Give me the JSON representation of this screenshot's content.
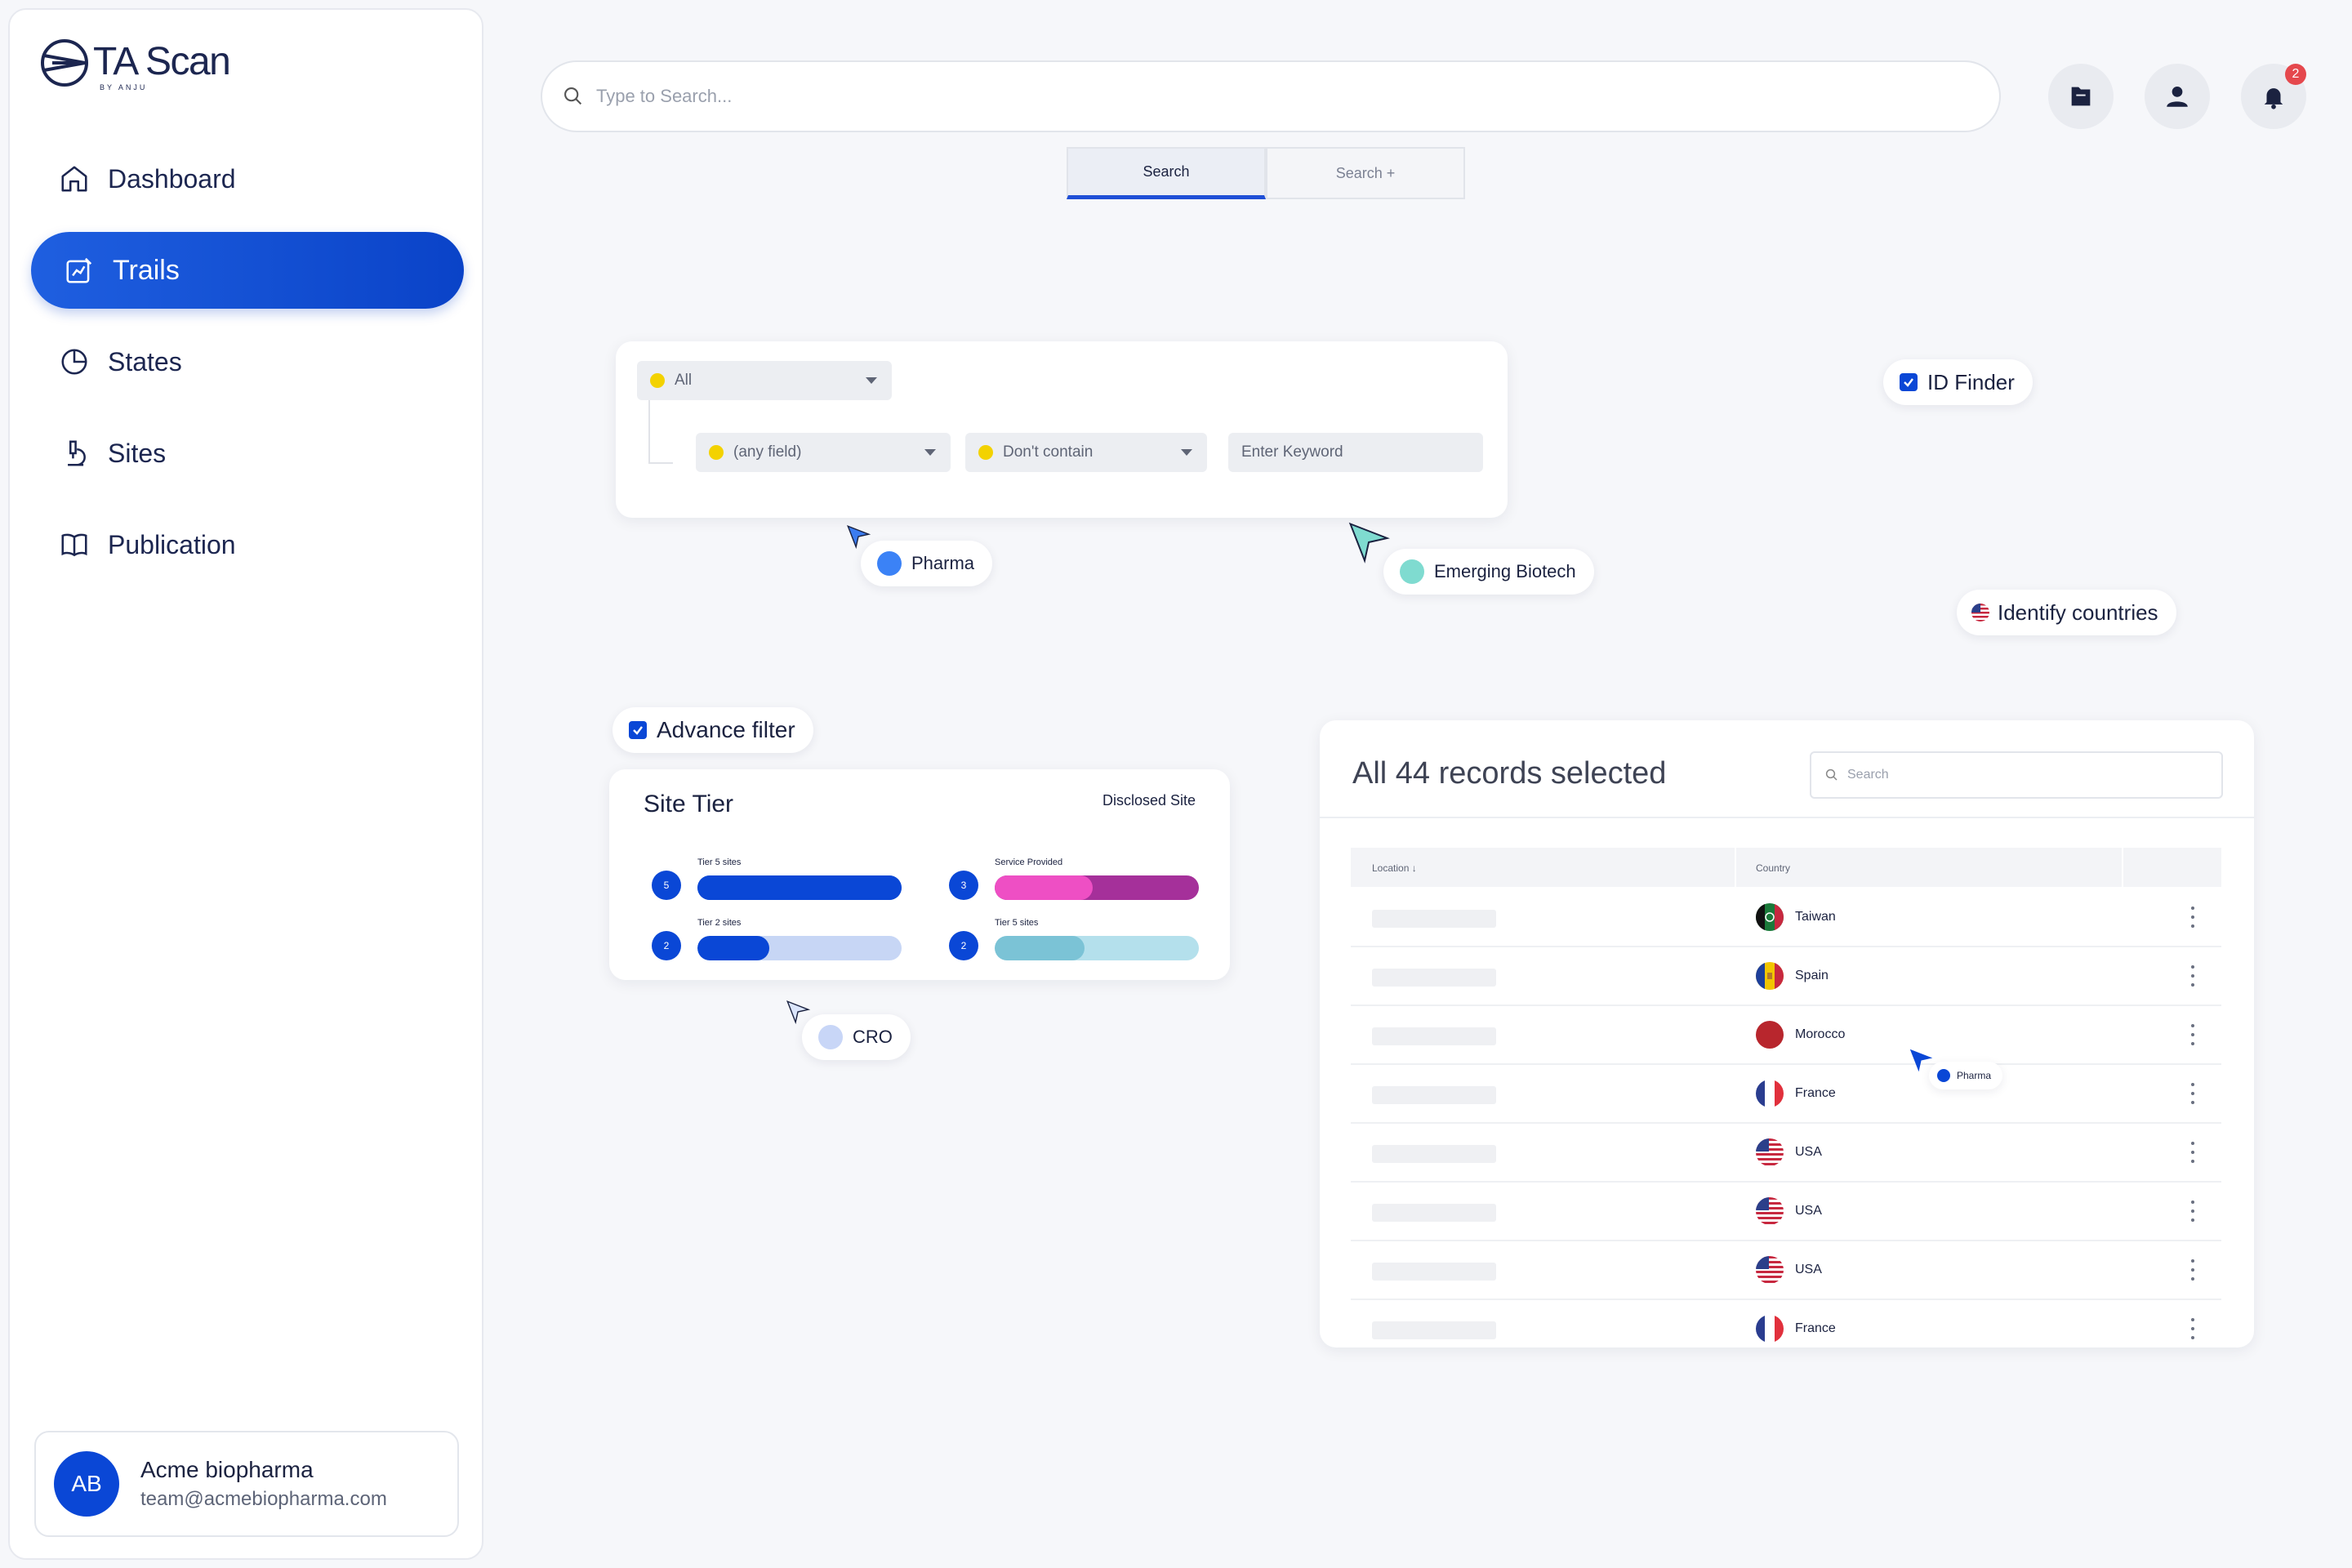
{
  "app": {
    "name": "TA Scan",
    "tagline": "BY ANJU"
  },
  "sidebar": {
    "items": [
      {
        "label": "Dashboard",
        "icon": "home-icon"
      },
      {
        "label": "Trails",
        "icon": "chart-edit-icon",
        "active": true
      },
      {
        "label": "States",
        "icon": "pie-chart-icon"
      },
      {
        "label": "Sites",
        "icon": "microscope-icon"
      },
      {
        "label": "Publication",
        "icon": "book-icon"
      }
    ],
    "account": {
      "initials": "AB",
      "name": "Acme biopharma",
      "email": "team@acmebiopharma.com"
    }
  },
  "header": {
    "search_placeholder": "Type to Search...",
    "notification_count": "2",
    "tabs": [
      {
        "label": "Search",
        "active": true
      },
      {
        "label": "Search +",
        "active": false
      }
    ]
  },
  "filter": {
    "scope": "All",
    "field": "(any field)",
    "operator": "Don't contain",
    "keyword_placeholder": "Enter Keyword"
  },
  "chips": {
    "pharma": "Pharma",
    "emerging_biotech": "Emerging Biotech",
    "id_finder": "ID Finder",
    "identify_countries": "Identify countries",
    "advance_filter": "Advance filter",
    "cro": "CRO",
    "pharma_small": "Pharma"
  },
  "site_tier": {
    "title": "Site Tier",
    "subtitle": "Disclosed Site",
    "items": [
      {
        "num": "5",
        "label": "Tier 5 sites",
        "fill": 1.0,
        "color": "#0a47d6",
        "track": "#0a47d6"
      },
      {
        "num": "3",
        "label": "Service Provided",
        "fill": 0.48,
        "color": "#ee4fc4",
        "track": "#a5309a"
      },
      {
        "num": "2",
        "label": "Tier 2 sites",
        "fill": 0.35,
        "color": "#0a47d6",
        "track": "#c7d6f5"
      },
      {
        "num": "2",
        "label": "Tier 5 sites",
        "fill": 0.44,
        "color": "#7bc3d6",
        "track": "#b4e0ec"
      }
    ]
  },
  "records": {
    "title": "All 44 records selected",
    "search_placeholder": "Search",
    "columns": [
      "Location",
      "Country"
    ],
    "rows": [
      {
        "country": "Taiwan",
        "flag": "taiwan-flag-icon"
      },
      {
        "country": "Spain",
        "flag": "spain-flag-icon"
      },
      {
        "country": "Morocco",
        "flag": "morocco-flag-icon"
      },
      {
        "country": "France",
        "flag": "france-flag-icon"
      },
      {
        "country": "USA",
        "flag": "usa-flag-icon"
      },
      {
        "country": "USA",
        "flag": "usa-flag-icon"
      },
      {
        "country": "USA",
        "flag": "usa-flag-icon"
      },
      {
        "country": "France",
        "flag": "france-flag-icon"
      }
    ]
  },
  "colors": {
    "accent": "#0a47d6",
    "chip_pharma": "#3b82f6",
    "chip_biotech": "#7fdbd0",
    "chip_cro": "#c8d6f7"
  }
}
